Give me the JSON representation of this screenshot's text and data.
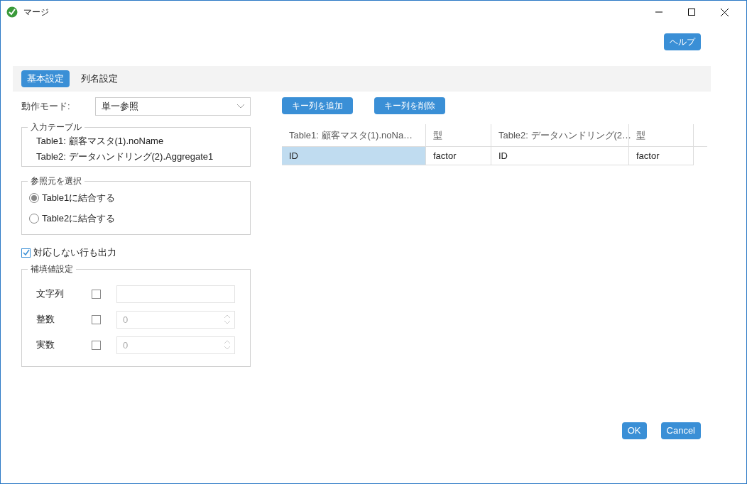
{
  "window": {
    "title": "マージ"
  },
  "help_button": "ヘルプ",
  "tabs": [
    {
      "label": "基本設定",
      "selected": true
    },
    {
      "label": "列名設定",
      "selected": false
    }
  ],
  "mode": {
    "label": "動作モード:",
    "value": "単一参照"
  },
  "input_tables": {
    "legend": "入力テーブル",
    "lines": [
      "Table1: 顧客マスタ(1).noName",
      "Table2: データハンドリング(2).Aggregate1"
    ]
  },
  "reference": {
    "legend": "参照元を選択",
    "options": [
      {
        "label": "Table1に結合する",
        "selected": true
      },
      {
        "label": "Table2に結合する",
        "selected": false
      }
    ]
  },
  "unmatched": {
    "label": "対応しない行も出力",
    "checked": true
  },
  "fill": {
    "legend": "補填値設定",
    "rows": [
      {
        "label": "文字列",
        "checked": false,
        "kind": "text"
      },
      {
        "label": "整数",
        "checked": false,
        "kind": "number",
        "placeholder": "0"
      },
      {
        "label": "実数",
        "checked": false,
        "kind": "number",
        "placeholder": "0"
      }
    ]
  },
  "key_buttons": [
    "キー列を追加",
    "キー列を削除"
  ],
  "table": {
    "columns": [
      "Table1: 顧客マスタ(1).noNa…",
      "型",
      "Table2: データハンドリング(2…",
      "型"
    ],
    "rows": [
      {
        "cells": [
          {
            "text": "ID",
            "selected": true
          },
          {
            "text": "factor",
            "selected": false
          },
          {
            "text": "ID",
            "selected": false
          },
          {
            "text": "factor",
            "selected": false
          }
        ]
      }
    ]
  },
  "footer_buttons": [
    "OK",
    "Cancel"
  ]
}
